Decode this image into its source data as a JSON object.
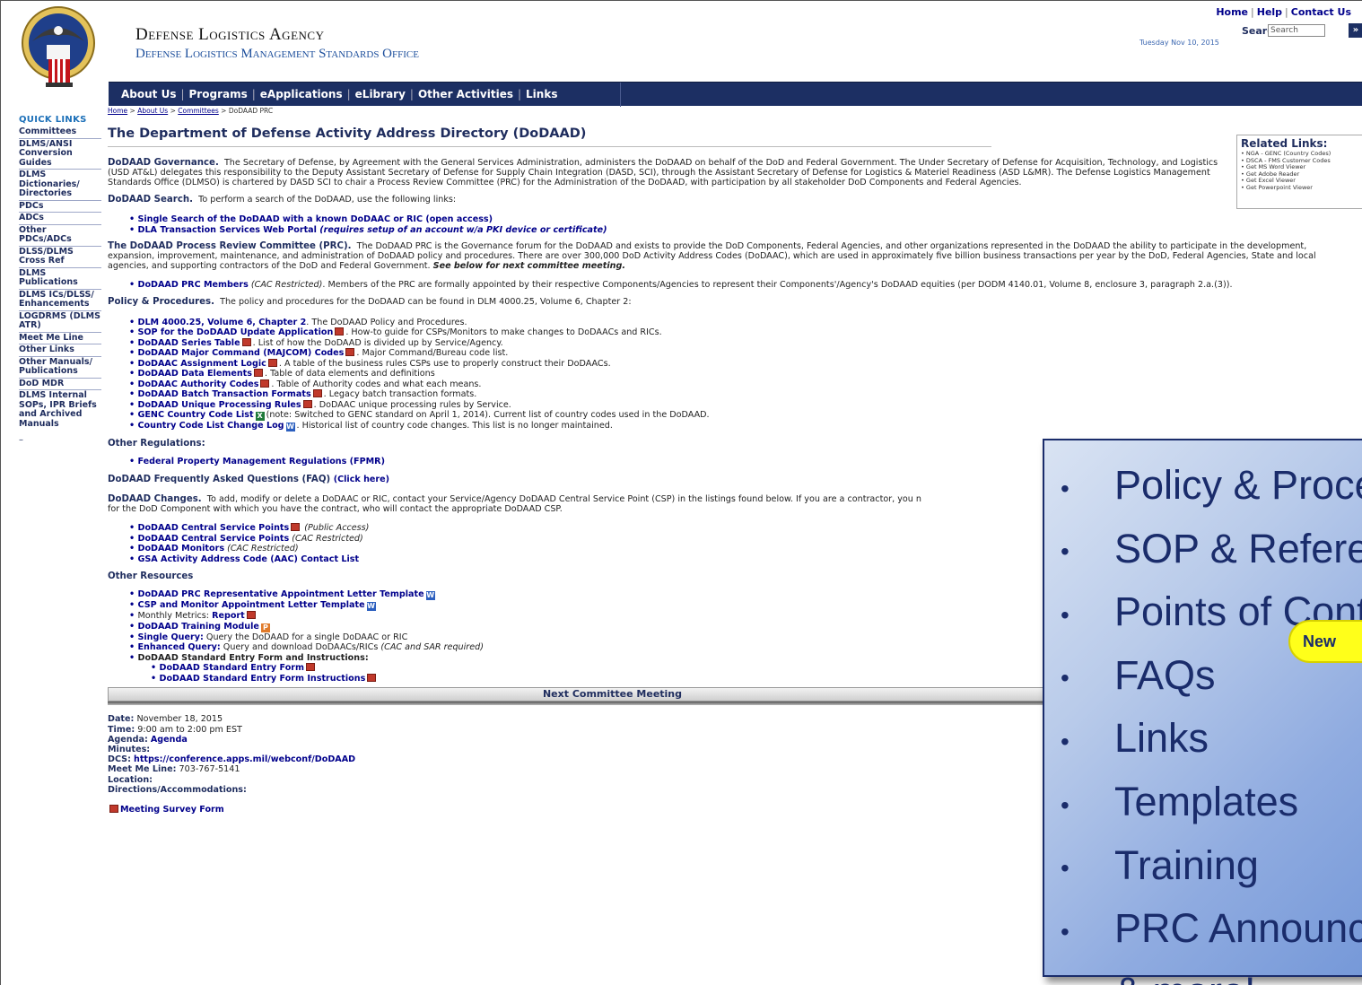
{
  "header": {
    "agency": "Defense Logistics Agency",
    "office": "Defense Logistics Management Standards Office",
    "top_links": [
      "Home",
      "Help",
      "Contact Us"
    ],
    "search_label": "Search:",
    "search_placeholder": "Search",
    "search_button": "»",
    "date": "Tuesday Nov 10, 2015"
  },
  "nav": [
    "About Us",
    "Programs",
    "eApplications",
    "eLibrary",
    "Other Activities",
    "Links"
  ],
  "quick_links": {
    "title": "QUICK LINKS",
    "items": [
      "Committees",
      "DLMS/ANSI Conversion Guides",
      "DLMS Dictionaries/ Directories",
      "PDCs",
      "ADCs",
      "Other PDCs/ADCs",
      "DLSS/DLMS Cross Ref",
      "DLMS Publications",
      "DLMS ICs/DLSS/ Enhancements",
      "LOGDRMS (DLMS ATR)",
      "Meet Me Line",
      "Other Links",
      "Other Manuals/ Publications",
      "DoD MDR",
      "DLMS Internal SOPs, IPR Briefs and Archived Manuals"
    ],
    "trailing": "–"
  },
  "breadcrumb": [
    "Home",
    "About Us",
    "Committees",
    "DoDAAD PRC"
  ],
  "page_title": "The Department of Defense Activity Address Directory (DoDAAD)",
  "related": {
    "title": "Related Links:",
    "items": [
      "NGA - GENC (Country Codes)",
      "DSCA - FMS Customer Codes",
      "Get MS Word Viewer",
      "Get Adobe Reader",
      "Get Excel Viewer",
      "Get Powerpoint Viewer"
    ]
  },
  "governance": {
    "lead": "DoDAAD Governance.",
    "text": "The Secretary of Defense, by Agreement with the General Services Administration, administers the DoDAAD on behalf of the DoD and Federal Government. The Under Secretary of Defense for Acquisition, Technology, and Logistics (USD AT&L) delegates this responsibility to the Deputy Assistant Secretary of Defense for Supply Chain Integration (DASD, SCI), through the Assistant Secretary of Defense for Logistics & Materiel Readiness (ASD L&MR). The Defense Logistics Management Standards Office (DLMSO) is chartered by DASD SCI to chair a Process Review Committee (PRC) for the Administration of the DoDAAD, with participation by all stakeholder DoD Components and Federal Agencies."
  },
  "search_section": {
    "lead": "DoDAAD Search.",
    "text": "To perform a search of the DoDAAD, use the following links:",
    "links": [
      "Single Search of the DoDAAD with a known DoDAAC or RIC (open access)",
      "DLA Transaction Services Web Portal"
    ],
    "link2_note": "(requires setup of an account w/a PKI device or certificate)"
  },
  "prc": {
    "lead": "The DoDAAD Process Review Committee (PRC).",
    "text": "The DoDAAD PRC is the Governance forum for the DoDAAD and exists to provide the DoD Components, Federal Agencies, and other organizations represented in the DoDAAD the ability to participate in the development, expansion, improvement, maintenance, and administration of DoDAAD policy and procedures. There are over 300,000 DoD Activity Address Codes (DoDAAC), which are used in approximately five billion business transactions per year by the DoD, Federal Agencies, State and local agencies, and supporting contractors of the DoD and Federal Government.",
    "text_bold": "See below for next committee meeting.",
    "member_link": "DoDAAD PRC Members",
    "member_restricted": "(CAC Restricted)",
    "member_text": ". Members of the PRC are formally appointed by their respective Components/Agencies to represent their Components'/Agency's DoDAAD equities (per DODM 4140.01, Volume 8, enclosure 3, paragraph 2.a.(3))."
  },
  "policy": {
    "lead": "Policy & Procedures.",
    "text": "The policy and procedures for the DoDAAD can be found in DLM 4000.25, Volume 6, Chapter 2:",
    "items": [
      {
        "link": "DLM 4000.25, Volume 6, Chapter 2",
        "icon": "none",
        "text": ". The DoDAAD Policy and Procedures."
      },
      {
        "link": "SOP for the DoDAAD Update Application",
        "icon": "pdf",
        "text": ". How-to guide for CSPs/Monitors to make changes to DoDAACs and RICs."
      },
      {
        "link": "DoDAAD Series Table",
        "icon": "pdf",
        "text": ". List of how the DoDAAD is divided up by Service/Agency."
      },
      {
        "link": "DoDAAD Major Command (MAJCOM) Codes",
        "icon": "pdf",
        "text": ". Major Command/Bureau code list."
      },
      {
        "link": "DoDAAC Assignment Logic",
        "icon": "pdf",
        "text": ". A table of the business rules CSPs use to properly construct their DoDAACs."
      },
      {
        "link": "DoDAAD Data Elements",
        "icon": "pdf",
        "text": ". Table of data elements and definitions"
      },
      {
        "link": "DoDAAC Authority Codes",
        "icon": "pdf",
        "text": ". Table of Authority codes and what each means."
      },
      {
        "link": "DoDAAD Batch Transaction Formats",
        "icon": "pdf",
        "text": ". Legacy batch transaction formats."
      },
      {
        "link": "DoDAAD Unique Processing Rules",
        "icon": "pdf",
        "text": ". DoDAAC unique processing rules by Service."
      },
      {
        "link": "GENC Country Code List",
        "icon": "xls",
        "text": "(note: Switched to GENC standard on April 1, 2014). Current list of country codes used in the DoDAAD."
      },
      {
        "link": "Country Code List Change Log",
        "icon": "word",
        "text": ". Historical list of country code changes. This list is no longer maintained."
      }
    ]
  },
  "other_regulations": {
    "title": "Other Regulations:",
    "link": "Federal Property Management Regulations (FPMR)"
  },
  "faq": {
    "title": "DoDAAD Frequently Asked Questions (FAQ)",
    "link": "(Click here)"
  },
  "changes": {
    "lead": "DoDAAD Changes.",
    "text": "To add, modify or delete a DoDAAC or RIC, contact your Service/Agency DoDAAD Central Service Point (CSP) in the listings found below. If you are a contractor, you n",
    "text2": "for the DoD Component with which you have the contract, who will contact the appropriate DoDAAD CSP.",
    "items": [
      {
        "link": "DoDAAD Central Service Points",
        "icon": "pdf",
        "note": "(Public Access)"
      },
      {
        "link": "DoDAAD Central Service Points",
        "icon": "none",
        "note": "(CAC Restricted)"
      },
      {
        "link": "DoDAAD Monitors",
        "icon": "none",
        "note": "(CAC Restricted)"
      },
      {
        "link": "GSA Activity Address Code (AAC) Contact List",
        "icon": "none",
        "note": ""
      }
    ]
  },
  "other_resources": {
    "title": "Other Resources",
    "items": [
      {
        "prefix": "",
        "link": "DoDAAD PRC Representative Appointment Letter Template",
        "icon": "word",
        "suffix": ""
      },
      {
        "prefix": "",
        "link": "CSP and Monitor Appointment Letter Template",
        "icon": "word",
        "suffix": ""
      },
      {
        "prefix": "Monthly Metrics: ",
        "link": "Report",
        "icon": "pdf",
        "suffix": ""
      },
      {
        "prefix": "",
        "link": "DoDAAD Training Module",
        "icon": "ppt",
        "suffix": ""
      },
      {
        "prefix": "",
        "link": "Single Query:",
        "icon": "none",
        "suffix": " Query the DoDAAD for a single DoDAAC or RIC"
      },
      {
        "prefix": "",
        "link": "Enhanced Query:",
        "icon": "none",
        "suffix": " Query and download DoDAACs/RICs "
      }
    ],
    "enhanced_note": "(CAC and SAR required)",
    "form_title": "DoDAAD Standard Entry Form and Instructions:",
    "form_items": [
      "DoDAAD Standard Entry Form",
      "DoDAAD Standard Entry Form Instructions"
    ]
  },
  "meeting": {
    "title": "Next Committee Meeting",
    "date_label": "Date:",
    "date": "November 18, 2015",
    "time_label": "Time:",
    "time": "9:00 am to 2:00 pm EST",
    "agenda_label": "Agenda:",
    "agenda": "Agenda",
    "minutes_label": "Minutes:",
    "dcs_label": "DCS:",
    "dcs": "https://conference.apps.mil/webconf/DoDAAD",
    "meetme_label": "Meet Me Line:",
    "meetme": "703-767-5141",
    "location_label": "Location:",
    "directions_label": "Directions/Accommodations:",
    "survey": "Meeting Survey Form"
  },
  "callout": {
    "items": [
      "Policy & Procedures",
      "SOP & Reference",
      "Points of Contact",
      "FAQs",
      "Links",
      "Templates",
      "Training",
      "PRC Announcements",
      "& more!"
    ],
    "bullet": "•",
    "badge": "New"
  }
}
